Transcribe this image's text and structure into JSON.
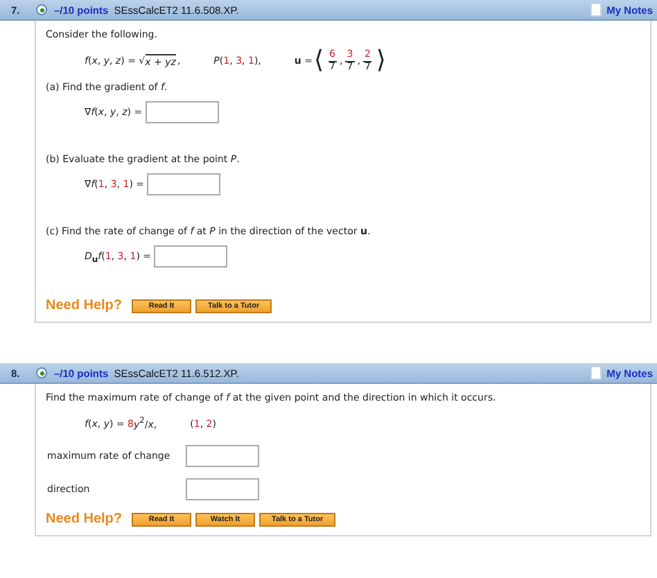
{
  "questions": [
    {
      "number": "7.",
      "points": "–/10 points",
      "code": "SEssCalcET2 11.6.508.XP.",
      "notes": "My Notes",
      "body": [
        {
          "kind": "para",
          "text": "Consider the following."
        },
        {
          "kind": "formula",
          "segments": [
            {
              "kind": "text",
              "text": "*f*(*x*, *y*, *z*) = √"
            },
            {
              "kind": "sqrt",
              "text": "*x* + *yz*"
            },
            {
              "kind": "text",
              "text": ","
            },
            {
              "kind": "gap"
            },
            {
              "kind": "text",
              "text": "*P*("
            },
            {
              "kind": "num",
              "text": "1"
            },
            {
              "kind": "text",
              "text": ", "
            },
            {
              "kind": "num",
              "text": "3"
            },
            {
              "kind": "text",
              "text": ", "
            },
            {
              "kind": "num",
              "text": "1"
            },
            {
              "kind": "text",
              "text": "),"
            },
            {
              "kind": "gap"
            },
            {
              "kind": "text",
              "text": "**u** ="
            },
            {
              "kind": "bracket",
              "text": "⟨"
            },
            {
              "kind": "frac",
              "num": "6",
              "den": "7"
            },
            {
              "kind": "text",
              "text": ","
            },
            {
              "kind": "frac",
              "num": "3",
              "den": "7"
            },
            {
              "kind": "text",
              "text": ","
            },
            {
              "kind": "frac",
              "num": "2",
              "den": "7"
            },
            {
              "kind": "bracket",
              "text": "⟩"
            }
          ]
        },
        {
          "kind": "para",
          "text": "(a) Find the gradient of *f*."
        },
        {
          "kind": "answer",
          "segments": [
            {
              "kind": "text",
              "text": "∇*f*(*x*, *y*, *z*) ="
            }
          ]
        },
        {
          "kind": "para",
          "text": "(b) Evaluate the gradient at the point *P*."
        },
        {
          "kind": "answer",
          "segments": [
            {
              "kind": "text",
              "text": "∇*f*("
            },
            {
              "kind": "num",
              "text": "1"
            },
            {
              "kind": "text",
              "text": ", "
            },
            {
              "kind": "num",
              "text": "3"
            },
            {
              "kind": "text",
              "text": ", "
            },
            {
              "kind": "num",
              "text": "1"
            },
            {
              "kind": "text",
              "text": ") ="
            }
          ]
        },
        {
          "kind": "para",
          "text": "(c) Find the rate of change of *f* at *P* in the direction of the vector **u**."
        },
        {
          "kind": "answer",
          "segments": [
            {
              "kind": "text",
              "text": "*D*"
            },
            {
              "kind": "sub",
              "text": "u"
            },
            {
              "kind": "text",
              "text": "*f*("
            },
            {
              "kind": "num",
              "text": "1"
            },
            {
              "kind": "text",
              "text": ", "
            },
            {
              "kind": "num",
              "text": "3"
            },
            {
              "kind": "text",
              "text": ", "
            },
            {
              "kind": "num",
              "text": "1"
            },
            {
              "kind": "text",
              "text": ") ="
            }
          ]
        }
      ],
      "help": "Need Help?",
      "buttons": [
        "Read It",
        "Talk to a Tutor"
      ]
    },
    {
      "number": "8.",
      "points": "–/10 points",
      "code": "SEssCalcET2 11.6.512.XP.",
      "notes": "My Notes",
      "body": [
        {
          "kind": "para",
          "text": "Find the maximum rate of change of *f* at the given point and the direction in which it occurs."
        },
        {
          "kind": "formula",
          "segments": [
            {
              "kind": "text",
              "text": "*f*(*x*, *y*) = "
            },
            {
              "kind": "num",
              "text": "8"
            },
            {
              "kind": "text",
              "text": "*y*$^{2}$/*x*,"
            },
            {
              "kind": "gap"
            },
            {
              "kind": "text",
              "text": "("
            },
            {
              "kind": "num",
              "text": "1"
            },
            {
              "kind": "text",
              "text": ", "
            },
            {
              "kind": "num",
              "text": "2"
            },
            {
              "kind": "text",
              "text": ")"
            }
          ]
        },
        {
          "kind": "labeled",
          "label": "maximum rate of change"
        },
        {
          "kind": "labeled",
          "label": "direction"
        }
      ],
      "help": "Need Help?",
      "buttons": [
        "Read It",
        "Watch It",
        "Talk to a Tutor"
      ]
    }
  ]
}
